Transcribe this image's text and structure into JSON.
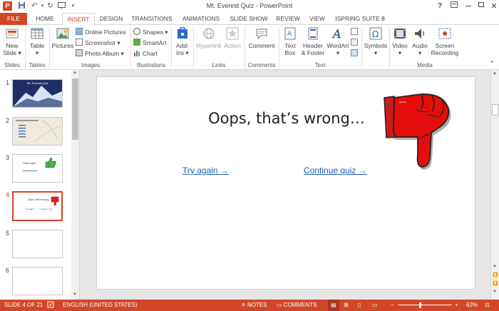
{
  "window": {
    "title": "Mt. Everest Quiz - PowerPoint"
  },
  "titlebar": {
    "help": "?"
  },
  "tabs": [
    "FILE",
    "HOME",
    "INSERT",
    "DESIGN",
    "TRANSITIONS",
    "ANIMATIONS",
    "SLIDE SHOW",
    "REVIEW",
    "VIEW",
    "ISPRING SUITE 8"
  ],
  "ribbon": {
    "slides": {
      "new_slide": "New",
      "new_slide_2": "Slide ▾",
      "group": "Slides"
    },
    "tables": {
      "table": "Table",
      "group": "Tables"
    },
    "images": {
      "pictures": "Pictures",
      "online_pictures": "Online Pictures",
      "screenshot": "Screenshot ▾",
      "photo_album": "Photo Album ▾",
      "group": "Images"
    },
    "illustrations": {
      "shapes": "Shapes ▾",
      "smartart": "SmartArt",
      "chart": "Chart",
      "group": "Illustrations"
    },
    "apps": {
      "addins": "Add-",
      "addins_2": "ins ▾"
    },
    "links": {
      "hyperlink": "Hyperlink",
      "action": "Action",
      "group": "Links"
    },
    "comments": {
      "comment": "Comment",
      "group": "Comments"
    },
    "text": {
      "textbox": "Text",
      "textbox_2": "Box",
      "header": "Header",
      "header_2": "& Footer",
      "wordart": "WordArt",
      "wordart_2": "▾",
      "group": "Text"
    },
    "symbols": {
      "symbols": "Symbols",
      "symbols_2": "▾"
    },
    "media": {
      "video": "Video",
      "video_2": "▾",
      "audio": "Audio",
      "audio_2": "▾",
      "screen": "Screen",
      "screen_2": "Recording",
      "group": "Media"
    }
  },
  "thumbnails": [
    {
      "num": "1",
      "caption": "Mt. Everest Quiz"
    },
    {
      "num": "2"
    },
    {
      "num": "3",
      "caption": "That's right!"
    },
    {
      "num": "4",
      "caption": "Oops, that's wrong...",
      "link1": "Try again",
      "link2": "Continue quiz"
    },
    {
      "num": "5"
    },
    {
      "num": "6"
    }
  ],
  "slide": {
    "title": "Oops, that’s wrong…",
    "link_try_again": "Try again →",
    "link_continue": "Continue quiz →"
  },
  "status": {
    "slide_count": "SLIDE 4 OF 21",
    "language": "ENGLISH (UNITED STATES)",
    "notes": "NOTES",
    "comments": "COMMENTS",
    "zoom": "62%",
    "zoom_minus": "−",
    "zoom_plus": "+"
  },
  "colors": {
    "accent": "#d24726",
    "link": "#1f5fb0"
  }
}
